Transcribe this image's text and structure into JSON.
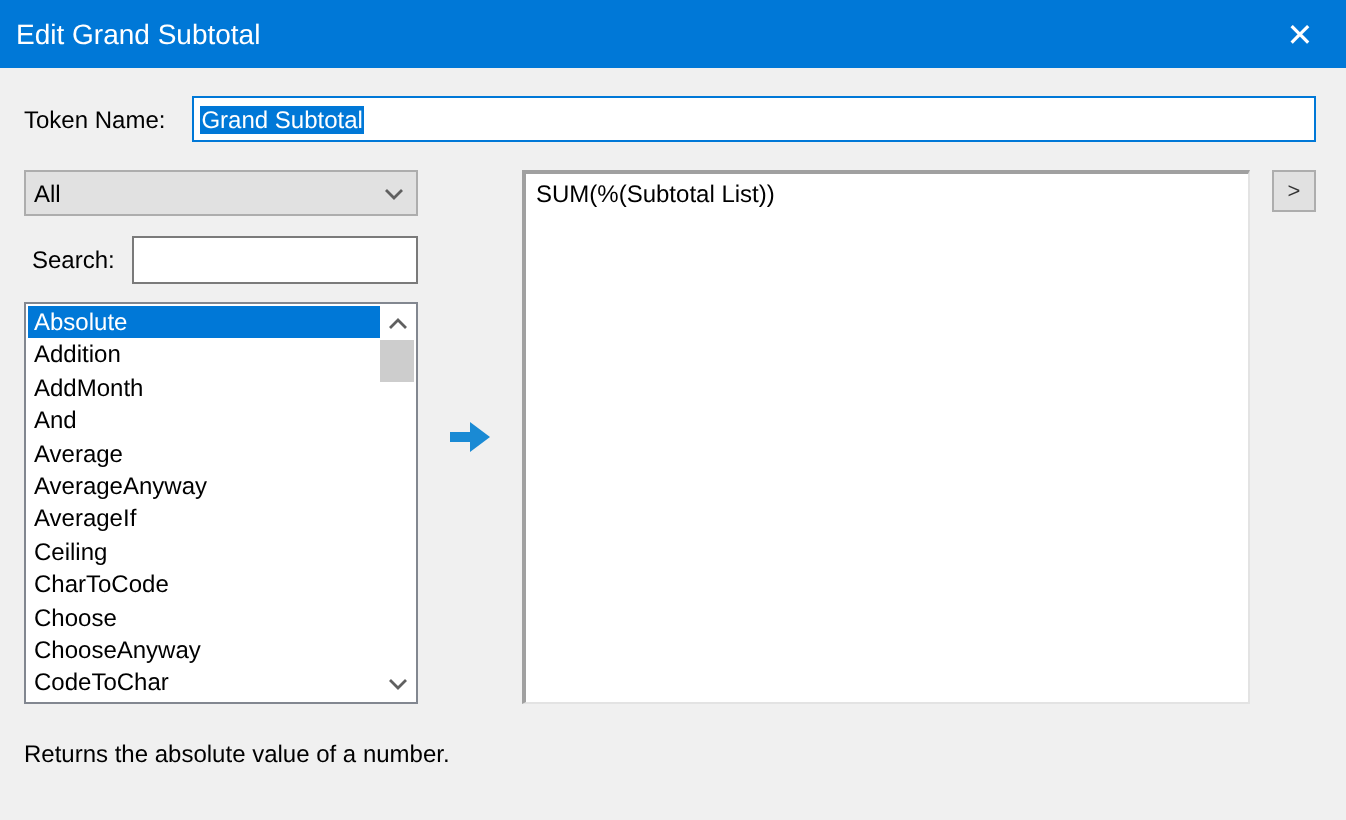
{
  "window": {
    "title": "Edit Grand Subtotal",
    "close": "✕"
  },
  "token_name": {
    "label": "Token Name:",
    "value": "Grand Subtotal",
    "text_selected": true
  },
  "category": {
    "value": "All"
  },
  "search": {
    "label": "Search:"
  },
  "functions": [
    {
      "label": "Absolute",
      "selected": true
    },
    {
      "label": "Addition",
      "selected": false
    },
    {
      "label": "AddMonth",
      "selected": false
    },
    {
      "label": "And",
      "selected": false
    },
    {
      "label": "Average",
      "selected": false
    },
    {
      "label": "AverageAnyway",
      "selected": false
    },
    {
      "label": "AverageIf",
      "selected": false
    },
    {
      "label": "Ceiling",
      "selected": false
    },
    {
      "label": "CharToCode",
      "selected": false
    },
    {
      "label": "Choose",
      "selected": false
    },
    {
      "label": "ChooseAnyway",
      "selected": false
    },
    {
      "label": "CodeToChar",
      "selected": false
    }
  ],
  "formula": {
    "value": "SUM(%(Subtotal List))"
  },
  "expand_button": {
    "label": ">"
  },
  "description": "Returns the absolute value of a number."
}
